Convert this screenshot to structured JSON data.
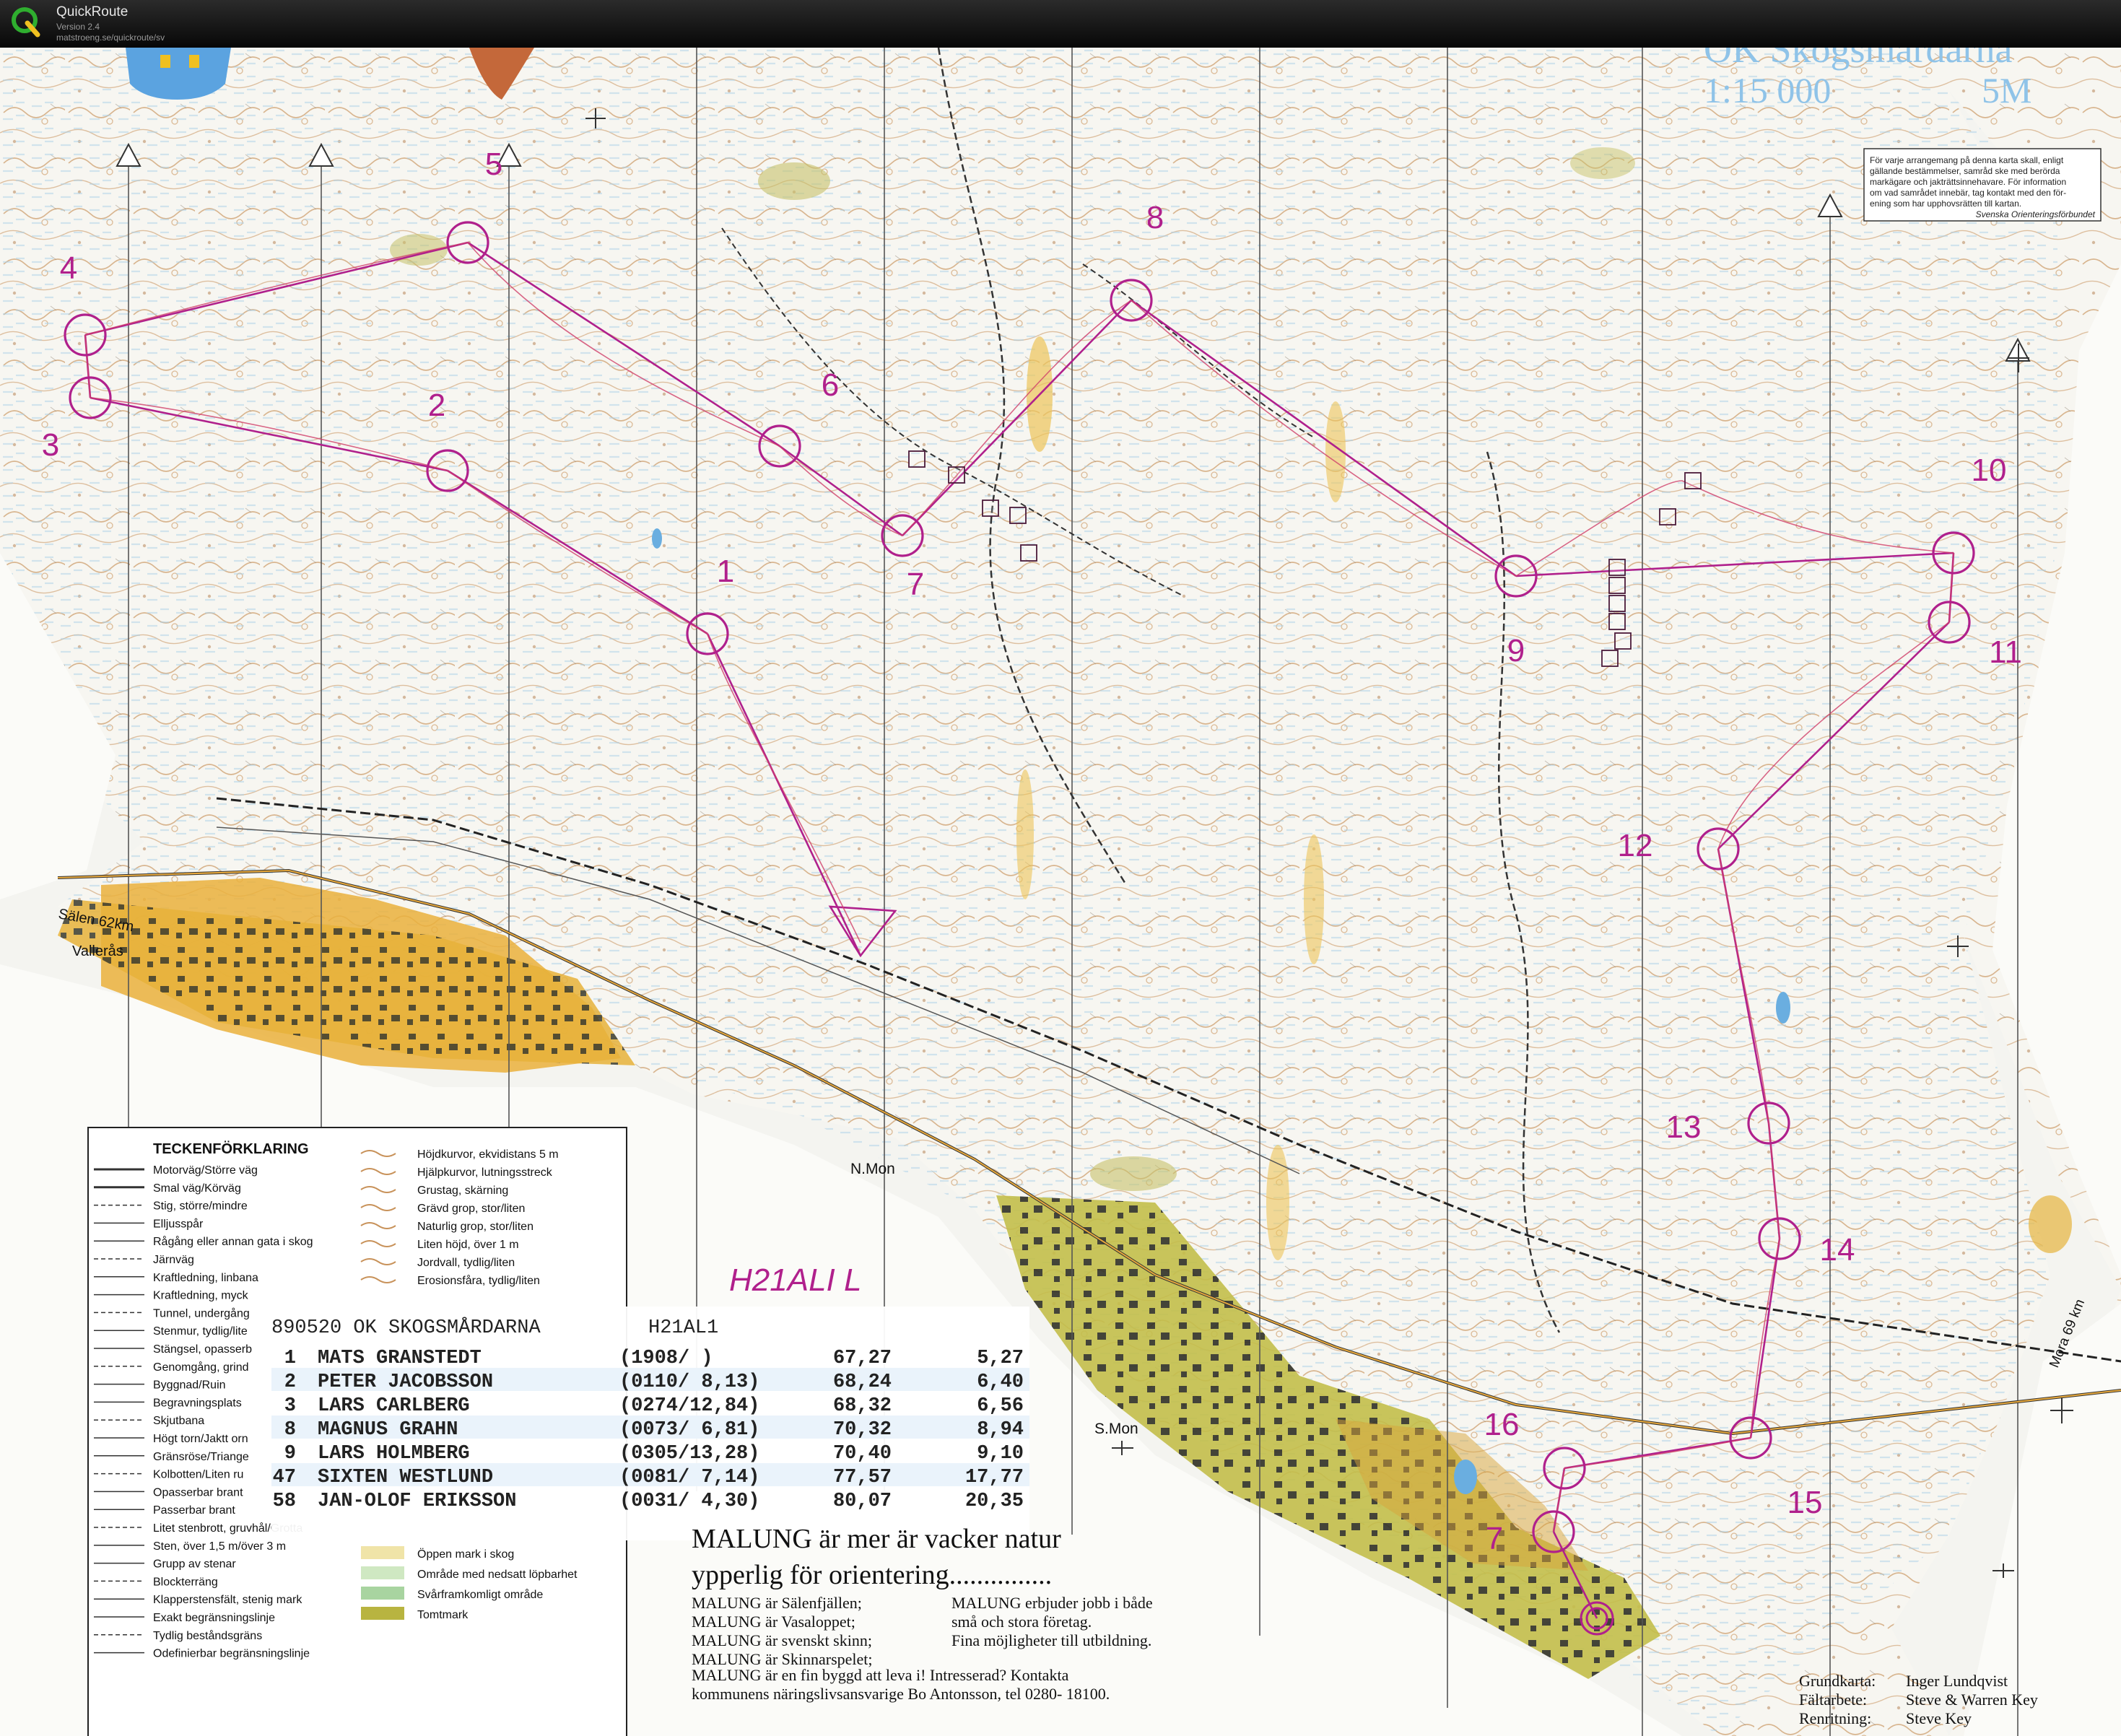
{
  "app": {
    "name": "QuickRoute",
    "version": "Version 2.4",
    "url": "matstroeng.se/quickroute/sv"
  },
  "map": {
    "club": "OK Skogsmårdarna",
    "scale": "1:15 000",
    "contour": "5M",
    "copyright_notice": [
      "För varje arrangemang på denna karta skall, enligt",
      "gällande bestämmelser, samråd ske med berörda",
      "markägare och jakträttsinnehavare. För information",
      "om vad samrådet innebär, tag kontakt med den för-",
      "ening som har upphovsrätten till kartan.",
      "Svenska Orienteringsförbundet"
    ],
    "place_labels": {
      "salen": "Sälen 62km",
      "valleras": "Vallerås",
      "nmon": "N.Mon",
      "smon": "S.Mon",
      "mora": "Mora 69 km"
    },
    "colors": {
      "course": "#b0208c",
      "route": "#d0406a",
      "yellow": "#f2b63a",
      "olive": "#b8b440",
      "water": "#6aaee0",
      "blue_text": "#8fc3e8"
    }
  },
  "course": {
    "controls": [
      {
        "label": "1"
      },
      {
        "label": "2"
      },
      {
        "label": "3"
      },
      {
        "label": "4"
      },
      {
        "label": "5"
      },
      {
        "label": "6"
      },
      {
        "label": "7"
      },
      {
        "label": "8"
      },
      {
        "label": "9"
      },
      {
        "label": "10"
      },
      {
        "label": "11"
      },
      {
        "label": "12"
      },
      {
        "label": "13"
      },
      {
        "label": "14"
      },
      {
        "label": "15"
      },
      {
        "label": "16"
      },
      {
        "label": "7"
      }
    ]
  },
  "handwritten_class": "H21ALI   L",
  "results": {
    "header_left": "890520 OK SKOGSMÅRDARNA",
    "header_right": "H21AL1",
    "rows": [
      {
        "place": "1",
        "name": "MATS GRANSTEDT",
        "code": "(1908/        )",
        "time": "67,27",
        "diff": "5,27"
      },
      {
        "place": "2",
        "name": "PETER JACOBSSON",
        "code": "(0110/ 8,13)",
        "time": "68,24",
        "diff": "6,40"
      },
      {
        "place": "3",
        "name": "LARS CARLBERG",
        "code": "(0274/12,84)",
        "time": "68,32",
        "diff": "6,56"
      },
      {
        "place": "8",
        "name": "MAGNUS GRAHN",
        "code": "(0073/ 6,81)",
        "time": "70,32",
        "diff": "8,94"
      },
      {
        "place": "9",
        "name": "LARS HOLMBERG",
        "code": "(0305/13,28)",
        "time": "70,40",
        "diff": "9,10"
      },
      {
        "place": "47",
        "name": "SIXTEN WESTLUND",
        "code": "(0081/ 7,14)",
        "time": "77,57",
        "diff": "17,77"
      },
      {
        "place": "58",
        "name": "JAN-OLOF ERIKSSON",
        "code": "(0031/ 4,30)",
        "time": "80,07",
        "diff": "20,35"
      }
    ]
  },
  "legend": {
    "title": "TECKENFÖRKLARING",
    "left": [
      "Motorväg/Större väg",
      "Smal väg/Körväg",
      "Stig, större/mindre",
      "Elljusspår",
      "Rågång eller annan gata i skog",
      "Järnväg",
      "Kraftledning, linbana",
      "Kraftledning, myck",
      "Tunnel, undergång",
      "Stenmur, tydlig/lite",
      "Stängsel, opasserb",
      "Genomgång, grind",
      "Byggnad/Ruin",
      "Begravningsplats",
      "Skjutbana",
      "Högt torn/Jaktt orn",
      "Gränsröse/Triange",
      "Kolbotten/Liten ru",
      "Opasserbar brant",
      "Passerbar brant",
      "Litet stenbrott, gruvhål/Grotta",
      "Sten, över 1,5 m/över 3 m",
      "Grupp av stenar",
      "Blockterräng",
      "Klapperstensfält, stenig mark",
      "Exakt begränsningslinje",
      "Tydlig beståndsgräns",
      "Odefinierbar begränsningslinje"
    ],
    "right": [
      "Höjdkurvor, ekvidistans 5 m",
      "Hjälpkurvor, lutningsstreck",
      "Grustag, skärning",
      "Grävd grop, stor/liten",
      "Naturlig grop, stor/liten",
      "Liten höjd, över 1 m",
      "Jordvall, tydlig/liten",
      "Erosionsfåra, tydlig/liten"
    ],
    "right_lower": [
      "Öppen mark i skog",
      "Område med nedsatt löpbarhet",
      "Svårframkomligt område",
      "Tomtmark"
    ]
  },
  "ad": {
    "headline1": "MALUNG är mer är vacker natur",
    "headline2": "ypperlig för orientering...............",
    "col1": [
      "MALUNG  är Sälenfjällen;",
      "MALUNG  är Vasaloppet;",
      "MALUNG  är svenskt skinn;",
      "MALUNG  är Skinnarspelet;"
    ],
    "col2": [
      "MALUNG erbjuder jobb i både",
      "små och stora företag.",
      "Fina möjligheter till utbildning."
    ],
    "footer1": "MALUNG  är en fin byggd att leva i!  Intresserad?  Kontakta",
    "footer2": "kommunens näringslivsansvarige Bo Antonsson, tel 0280- 18100."
  },
  "credits": [
    {
      "label": "Grundkarta:",
      "value": "Inger Lundqvist"
    },
    {
      "label": "Fältarbete:",
      "value": "Steve & Warren Key"
    },
    {
      "label": "Renritning:",
      "value": "Steve Key"
    }
  ]
}
